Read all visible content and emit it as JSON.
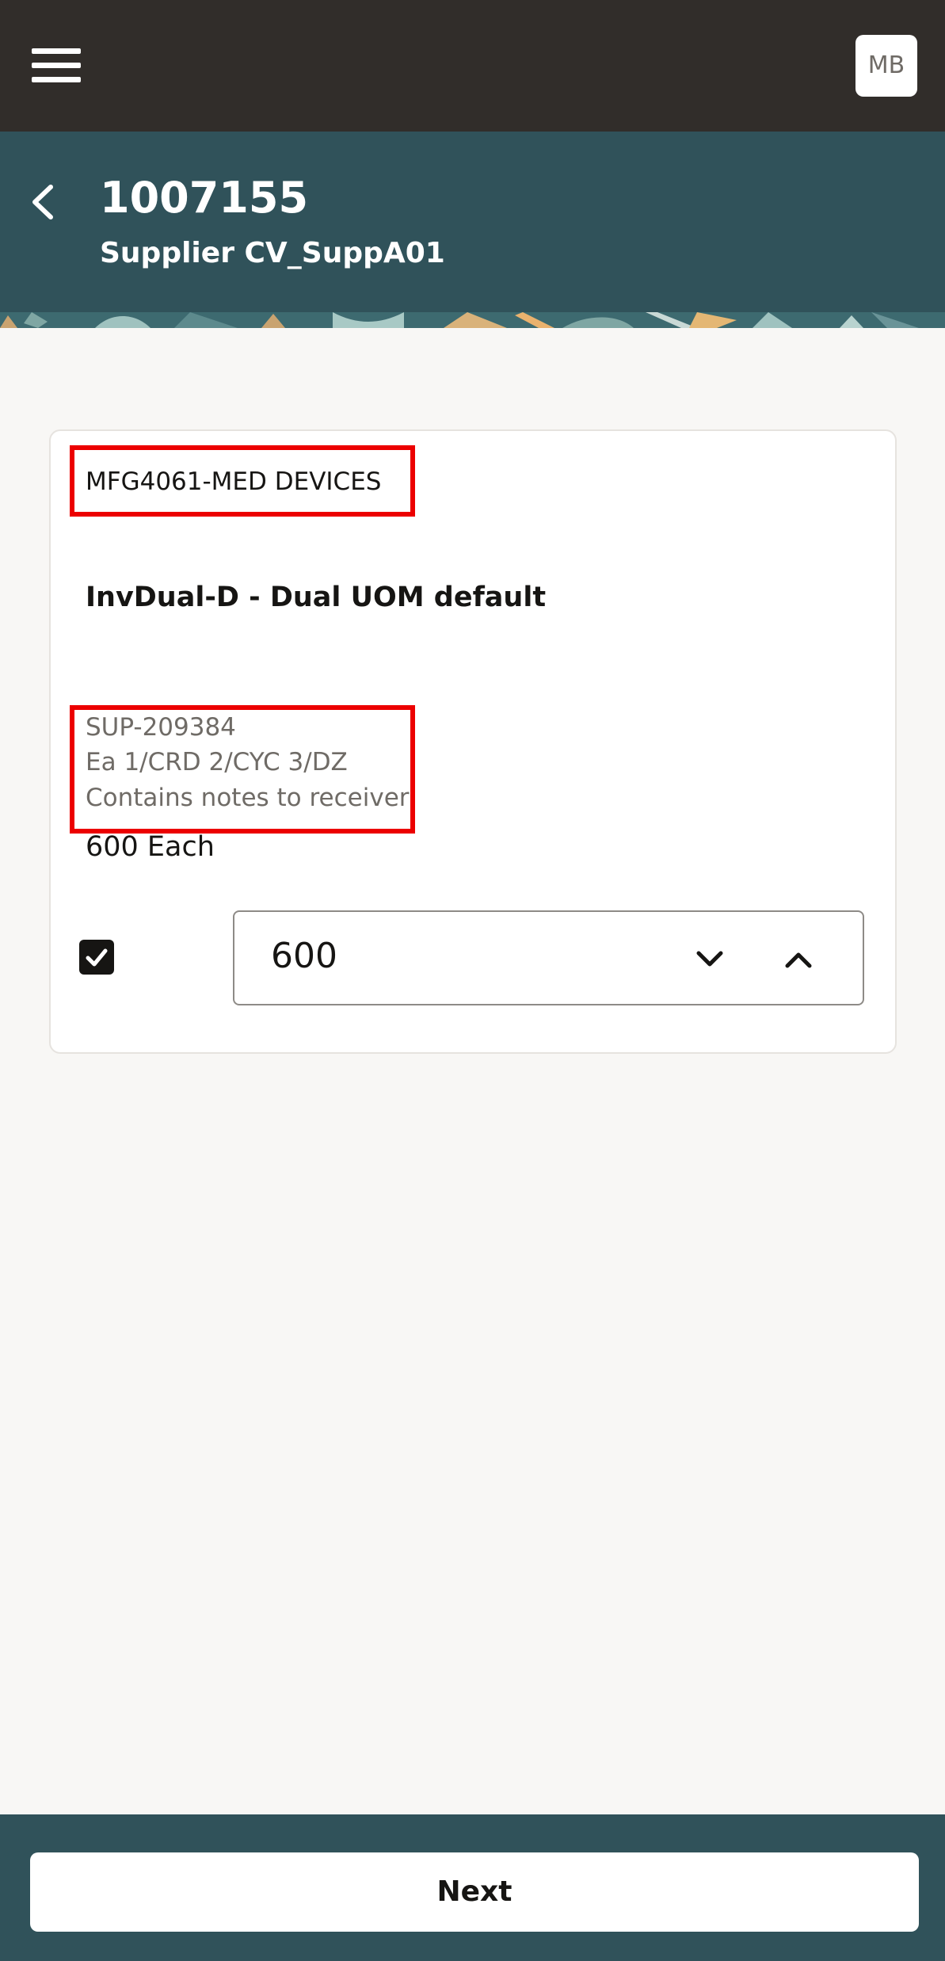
{
  "topbar": {
    "menu_icon": "hamburger-menu-icon",
    "avatar_initials": "MB"
  },
  "header": {
    "back_icon": "chevron-left-icon",
    "title": "1007155",
    "subtitle": "Supplier CV_SuppA01"
  },
  "card": {
    "organization": "MFG4061-MED DEVICES",
    "item_description": "InvDual-D - Dual UOM default",
    "details": [
      "SUP-209384",
      "Ea 1/CRD 2/CYC 3/DZ",
      "Contains notes to receiver"
    ],
    "quantity_text": "600 Each",
    "checkbox_checked": true,
    "stepper": {
      "value": "600",
      "decrement_icon": "chevron-down-icon",
      "increment_icon": "chevron-up-icon"
    }
  },
  "footer": {
    "next_label": "Next"
  },
  "colors": {
    "topbar": "#312d2a",
    "header": "#30525a",
    "background": "#f8f7f5",
    "highlight": "#ec0000"
  }
}
